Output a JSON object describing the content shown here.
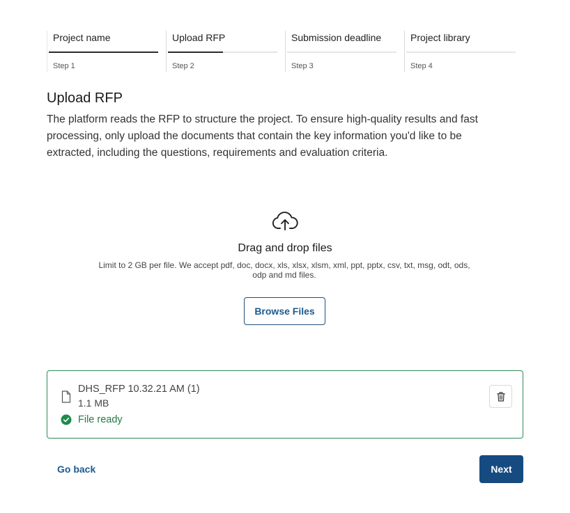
{
  "stepper": {
    "steps": [
      {
        "name": "Project name",
        "number": "Step 1",
        "progress": 1.0
      },
      {
        "name": "Upload RFP",
        "number": "Step 2",
        "progress": 0.5
      },
      {
        "name": "Submission deadline",
        "number": "Step 3",
        "progress": 0
      },
      {
        "name": "Project library",
        "number": "Step 4",
        "progress": 0
      }
    ]
  },
  "main": {
    "title": "Upload RFP",
    "description": "The platform reads the RFP to structure the project. To ensure high-quality results and fast processing, only upload the documents that contain the key information you'd like to be extracted, including the questions, requirements and evaluation criteria."
  },
  "dropzone": {
    "icon": "cloud-upload-icon",
    "title": "Drag and drop files",
    "hint": "Limit to 2 GB per file. We accept pdf, doc, docx, xls, xlsx, xlsm, xml, ppt, pptx, csv, txt, msg, odt, ods, odp and md files.",
    "browse_label": "Browse Files"
  },
  "file": {
    "name": "DHS_RFP 10.32.21 AM (1)",
    "size": "1.1 MB",
    "status": "File ready",
    "status_color": "#1f8a4c",
    "border_color": "#2e8b57"
  },
  "footer": {
    "back_label": "Go back",
    "next_label": "Next",
    "accent": "#154b80"
  }
}
